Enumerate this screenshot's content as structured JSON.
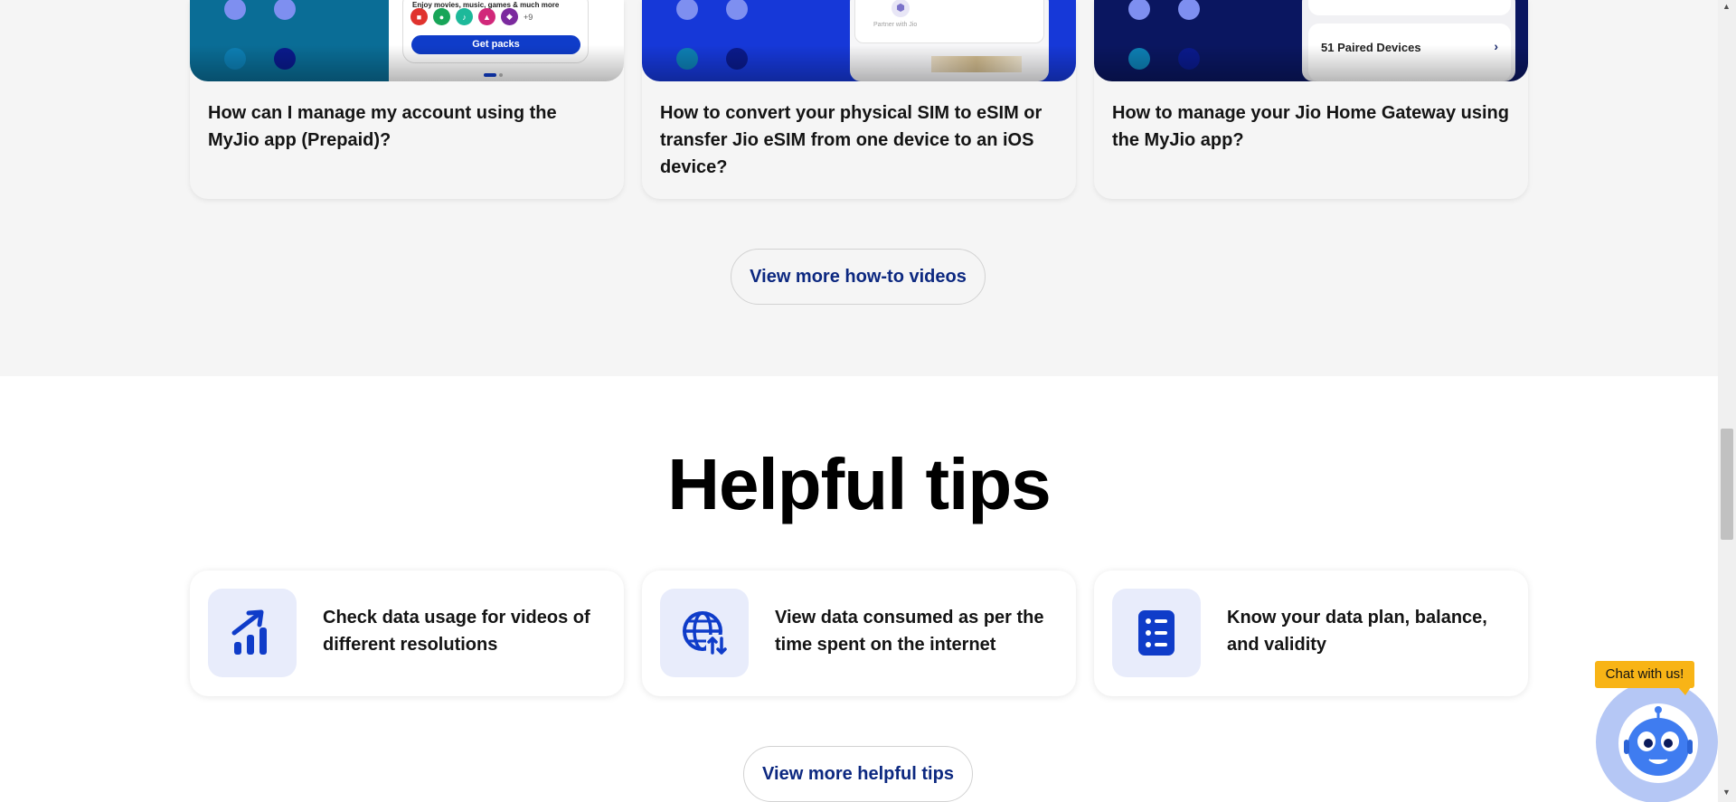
{
  "videos": {
    "cards": [
      {
        "title": "How can I manage my account using the MyJio app (Prepaid)?",
        "promo_text": "Enjoy movies, music, games & much more",
        "more_apps": "+9",
        "cta": "Get packs"
      },
      {
        "title": "How to convert your physical SIM to eSIM or transfer Jio eSIM from one device to an iOS device?",
        "partner_text": "Partner with Jio"
      },
      {
        "title": "How to manage your Jio Home Gateway using the MyJio app?",
        "devices_label": "51 Paired Devices"
      }
    ],
    "view_more_label": "View more how-to videos"
  },
  "tips": {
    "heading": "Helpful tips",
    "items": [
      {
        "text": "Check data usage for videos of different resolutions",
        "icon": "bar-chart-up-icon"
      },
      {
        "text": "View data consumed as per the time spent on the internet",
        "icon": "globe-data-icon"
      },
      {
        "text": "Know your data plan, balance, and validity",
        "icon": "list-document-icon"
      }
    ],
    "view_more_label": "View more helpful tips"
  },
  "chat": {
    "label": "Chat with us!"
  },
  "colors": {
    "primary_blue": "#0f3cc9",
    "link_navy": "#0c2880",
    "section_grey": "#f5f5f5",
    "tip_icon_bg": "#e8ecfb",
    "chat_yellow": "#f8b416",
    "bot_ring": "#b5c7f5",
    "bot_blue": "#3f7cf0"
  }
}
